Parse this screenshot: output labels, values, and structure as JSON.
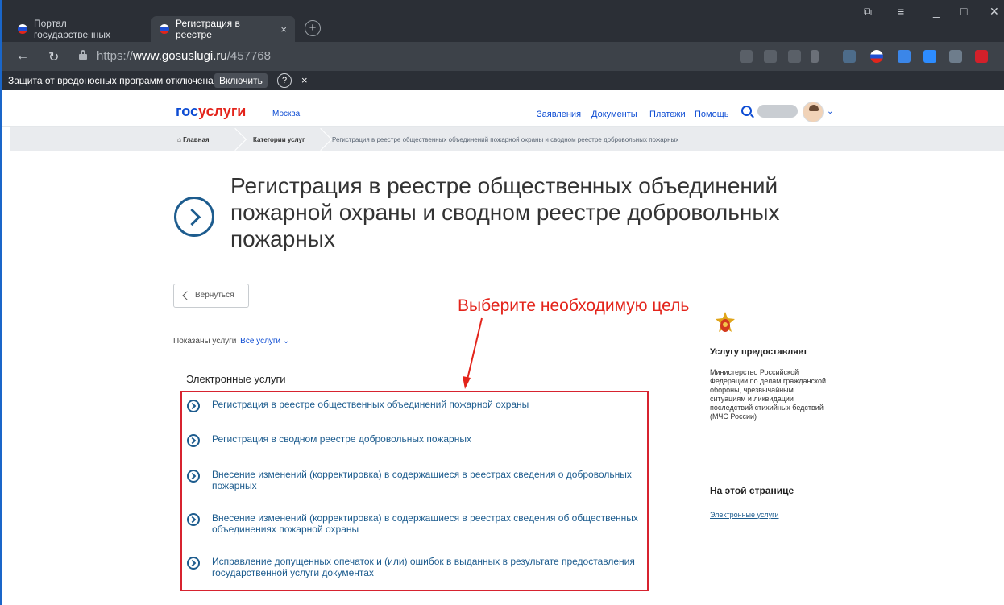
{
  "browser": {
    "tabs": [
      {
        "label": "Портал государственных"
      },
      {
        "label": "Регистрация в реестре",
        "close": "×"
      }
    ],
    "new_tab": "+",
    "url_prefix": "https://",
    "url_host": "www.gosuslugi.ru",
    "url_path": "/457768",
    "security_message": "Защита от вредоносных программ отключена",
    "security_button": "Включить",
    "security_help": "?",
    "security_close": "×"
  },
  "header": {
    "logo_left": "гос",
    "logo_right": "услуги",
    "city": "Москва",
    "nav": [
      "Заявления",
      "Документы",
      "Платежи",
      "Помощь"
    ]
  },
  "breadcrumb": {
    "home": "Главная",
    "category": "Категории услуг",
    "current": "Регистрация в реестре общественных объединений пожарной охраны и сводном реестре добровольных пожарных"
  },
  "page": {
    "title": "Регистрация в реестре общественных объединений пожарной охраны и сводном реестре добровольных пожарных",
    "back_button": "Вернуться",
    "annotation": "Выберите необходимую цель",
    "shown_label": "Показаны услуги",
    "shown_filter": "Все услуги",
    "section_title": "Электронные услуги",
    "services": [
      "Регистрация в реестре общественных объединений пожарной охраны",
      "Регистрация в сводном реестре добровольных пожарных",
      "Внесение изменений (корректировка) в содержащиеся в реестрах сведения о добровольных пожарных",
      "Внесение изменений (корректировка) в содержащиеся в реестрах сведения об общественных объединениях пожарной охраны",
      "Исправление допущенных опечаток и (или) ошибок в выданных в результате предоставления государственной услуги документах"
    ]
  },
  "sidebar": {
    "provider_heading": "Услугу предоставляет",
    "provider": "Министерство Российской Федерации по делам гражданской обороны, чрезвычайным ситуациям и ликвидации последствий стихийных бедствий (МЧС России)",
    "onpage_heading": "На этой странице",
    "onpage_link": "Электронные услуги"
  },
  "colors": {
    "brand_blue": "#0d4cd3",
    "brand_red": "#e3241b",
    "link": "#1d5c8e",
    "annotation": "#e3241b"
  }
}
